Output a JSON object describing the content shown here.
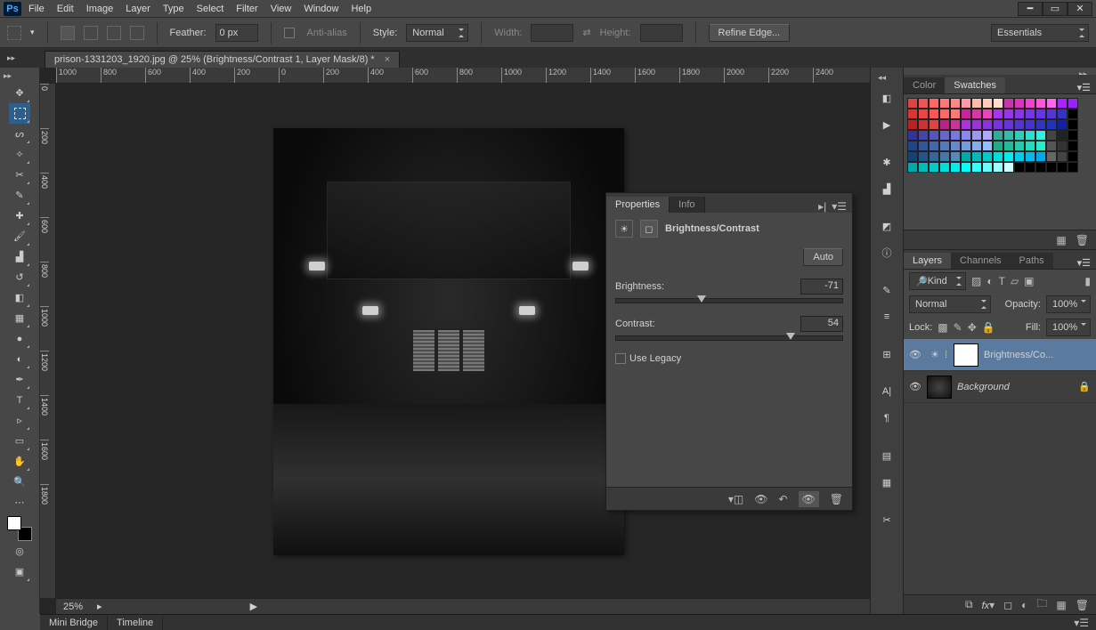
{
  "menu": [
    "File",
    "Edit",
    "Image",
    "Layer",
    "Type",
    "Select",
    "Filter",
    "View",
    "Window",
    "Help"
  ],
  "options": {
    "feather_label": "Feather:",
    "feather_value": "0 px",
    "antialias": "Anti-alias",
    "style_label": "Style:",
    "style_value": "Normal",
    "width_label": "Width:",
    "height_label": "Height:",
    "refine": "Refine Edge...",
    "workspace": "Essentials"
  },
  "doc_tab": "prison-1331203_1920.jpg @ 25% (Brightness/Contrast 1, Layer Mask/8) *",
  "ruler_h": [
    "1000",
    "800",
    "600",
    "400",
    "200",
    "0",
    "200",
    "400",
    "600",
    "800",
    "1000",
    "1200",
    "1400",
    "1600",
    "1800",
    "2000",
    "2200",
    "2400"
  ],
  "ruler_v": [
    "0",
    "200",
    "400",
    "600",
    "800",
    "1000",
    "1200",
    "1400",
    "1600",
    "1800"
  ],
  "zoom": "25%",
  "bottom_tabs": [
    "Mini Bridge",
    "Timeline"
  ],
  "color_tabs": [
    "Color",
    "Swatches"
  ],
  "swatch_colors": [
    "#d44",
    "#e55",
    "#f66",
    "#f77",
    "#f88",
    "#f9a",
    "#fba",
    "#fcb",
    "#fdc",
    "#c3a",
    "#d3b",
    "#e4c",
    "#f5d",
    "#f6e",
    "#a2f",
    "#92f",
    "#d33",
    "#e44",
    "#f55",
    "#f66",
    "#f77",
    "#c29",
    "#d3a",
    "#e4b",
    "#a3e",
    "#93e",
    "#83e",
    "#73e",
    "#63e",
    "#53d",
    "#33c",
    "#000",
    "#b22",
    "#c33",
    "#d44",
    "#b28",
    "#c39",
    "#a3d",
    "#93d",
    "#83d",
    "#73d",
    "#63d",
    "#53c",
    "#43c",
    "#33b",
    "#23b",
    "#12a",
    "#000",
    "#339",
    "#44a",
    "#55b",
    "#66c",
    "#77d",
    "#88e",
    "#99e",
    "#aaf",
    "#3a9",
    "#3ba",
    "#3cb",
    "#3dc",
    "#3ed",
    "#444",
    "#222",
    "#000",
    "#248",
    "#359",
    "#46a",
    "#57b",
    "#68c",
    "#79d",
    "#8ae",
    "#9bf",
    "#2a8",
    "#2b9",
    "#2ca",
    "#2db",
    "#2ec",
    "#555",
    "#333",
    "#000",
    "#147",
    "#258",
    "#369",
    "#47a",
    "#58b",
    "#0aa",
    "#0bb",
    "#0cc",
    "#0dd",
    "#0ee",
    "#0ce",
    "#0be",
    "#0ae",
    "#666",
    "#444",
    "#000",
    "#0aa",
    "#0bb",
    "#0cc",
    "#0dd",
    "#0ee",
    "#0ff",
    "#3ff",
    "#6ff",
    "#9ff",
    "#cff",
    "#000",
    "#000",
    "#000",
    "#000",
    "#000",
    "#000"
  ],
  "layers_tabs": [
    "Layers",
    "Channels",
    "Paths"
  ],
  "layers_opts": {
    "kind": "Kind",
    "blend": "Normal",
    "opacity_label": "Opacity:",
    "opacity": "100%",
    "lock_label": "Lock:",
    "fill_label": "Fill:",
    "fill": "100%"
  },
  "layers": [
    {
      "name": "Brightness/Co...",
      "selected": true,
      "mask": true,
      "bg": false
    },
    {
      "name": "Background",
      "selected": false,
      "mask": false,
      "bg": true
    }
  ],
  "properties": {
    "tabs": [
      "Properties",
      "Info"
    ],
    "title": "Brightness/Contrast",
    "auto": "Auto",
    "brightness_label": "Brightness:",
    "brightness_val": "-71",
    "contrast_label": "Contrast:",
    "contrast_val": "54",
    "legacy": "Use Legacy"
  }
}
